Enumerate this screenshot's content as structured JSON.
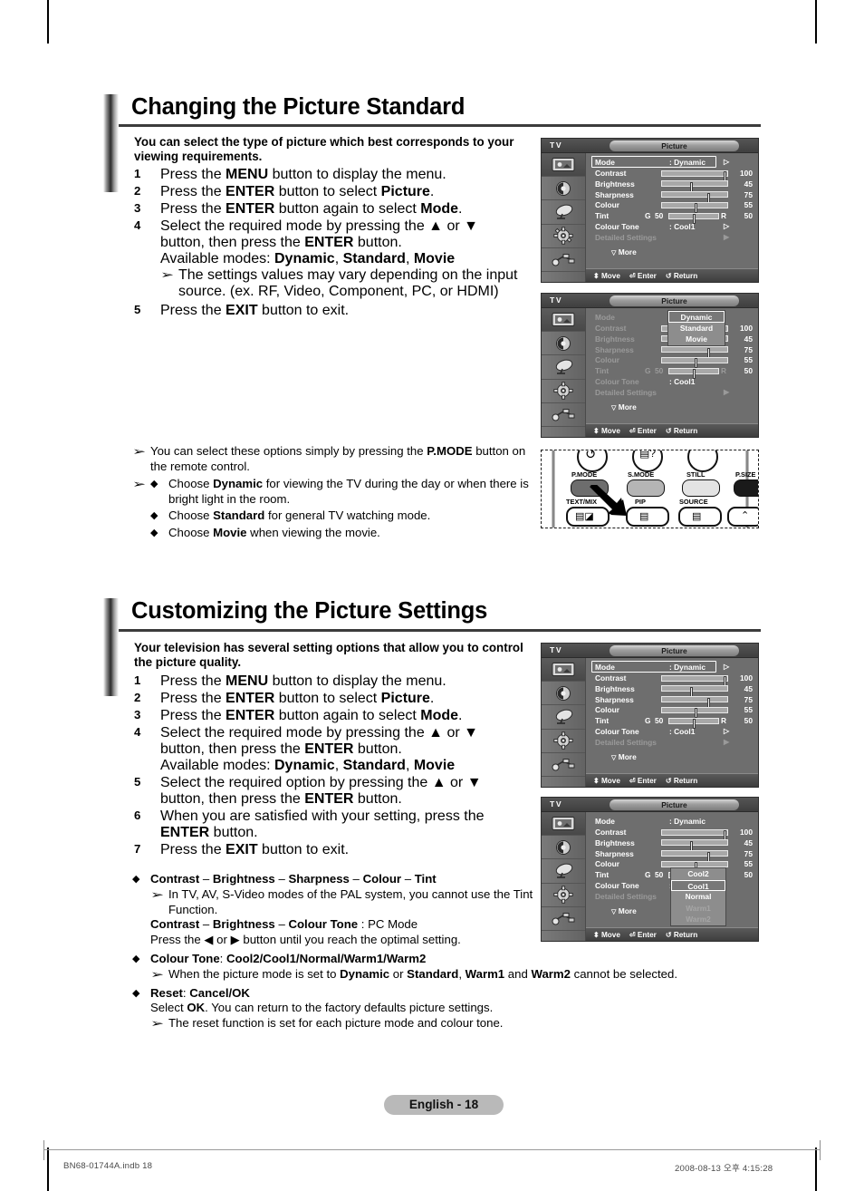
{
  "page": {
    "number_label": "English - 18",
    "footer_left": "BN68-01744A.indb   18",
    "footer_right": "2008-08-13   오후 4:15:28"
  },
  "sections": [
    {
      "heading": "Changing the Picture Standard",
      "intro": "You can select the type of picture which best corresponds to your viewing requirements.",
      "steps": [
        {
          "num": "1",
          "text_parts": "Press the MENU button to display the menu."
        },
        {
          "num": "2",
          "text_parts": "Press the ENTER button to select Picture."
        },
        {
          "num": "3",
          "text_parts": "Press the ENTER button again to select Mode."
        },
        {
          "num": "4",
          "text_parts": "Select the required mode by pressing the ▲ or ▼ button, then press the ENTER button."
        }
      ],
      "available_modes_label": "Available modes:",
      "available_modes": "Dynamic, Standard, Movie",
      "note_under_step4": "The settings values may vary depending on the input source. (ex. RF, Video, Component, PC, or HDMI)",
      "step5": {
        "num": "5",
        "text": "Press the EXIT button to exit."
      },
      "notes": [
        "You can select these options simply by pressing the P.MODE button on the remote control."
      ],
      "choose_bullets": [
        "Choose Dynamic for viewing the TV during the day or when there is bright light in the room.",
        "Choose Standard for general TV watching mode.",
        "Choose Movie when viewing the movie."
      ]
    },
    {
      "heading": "Customizing the Picture Settings",
      "intro": "Your television has several setting options that allow you to control the picture quality.",
      "steps": [
        {
          "num": "1",
          "text_parts": "Press the MENU button to display the menu."
        },
        {
          "num": "2",
          "text_parts": "Press the ENTER button to select Picture."
        },
        {
          "num": "3",
          "text_parts": "Press the ENTER button again to select Mode."
        },
        {
          "num": "4",
          "text_parts": "Select the required mode by pressing the ▲ or ▼ button, then press the ENTER button."
        }
      ],
      "available_modes_label": "Available modes:",
      "available_modes": "Dynamic, Standard, Movie",
      "steps2": [
        {
          "num": "5",
          "text_parts": "Select the required option by pressing the ▲ or ▼ button, then press the ENTER button."
        },
        {
          "num": "6",
          "text_parts": "When you are satisfied with your setting, press the ENTER button."
        },
        {
          "num": "7",
          "text_parts": "Press the EXIT button to exit."
        }
      ],
      "bullets": [
        {
          "title": "Contrast – Brightness – Sharpness – Colour – Tint",
          "note": "In TV, AV, S-Video modes of the PAL system, you cannot use the Tint Function.",
          "line2_bold": "Contrast – Brightness – Colour Tone",
          "line2_rest": ": PC Mode",
          "line3": "Press the ◀ or ▶ button until you reach the optimal setting."
        },
        {
          "title": "Colour Tone: Cool2/Cool1/Normal/Warm1/Warm2",
          "note": "When the picture mode is set to Dynamic or Standard, Warm1 and Warm2 cannot be selected."
        },
        {
          "title": "Reset: Cancel/OK",
          "line1": "Select OK. You can return to the factory defaults picture settings.",
          "note": "The reset function is set for each picture mode and colour tone."
        }
      ]
    }
  ],
  "osd": {
    "tv_label": "TV",
    "title": "Picture",
    "sidebar_icons": [
      "picture-icon",
      "sound-icon",
      "channel-icon",
      "setup-icon",
      "input-icon"
    ],
    "rows": {
      "mode_label": "Mode",
      "mode_value": ": Dynamic",
      "contrast_label": "Contrast",
      "contrast_value": "100",
      "brightness_label": "Brightness",
      "brightness_value": "45",
      "sharpness_label": "Sharpness",
      "sharpness_value": "75",
      "colour_label": "Colour",
      "colour_value": "55",
      "tint_label": "Tint",
      "tint_g": "G",
      "tint_g_value": "50",
      "tint_r": "R",
      "tint_r_value": "50",
      "colour_tone_label": "Colour Tone",
      "colour_tone_value": ": Cool1",
      "colour_tone_value_blank": ":",
      "detailed_label": "Detailed Settings",
      "more_label": "More"
    },
    "bottom": {
      "move": "Move",
      "enter": "Enter",
      "return": "Return"
    },
    "mode_options": [
      "Dynamic",
      "Standard",
      "Movie"
    ],
    "tone_options": [
      "Cool2",
      "Cool1",
      "Normal",
      "Warm1",
      "Warm2"
    ]
  },
  "remote": {
    "labels_top": [
      "P.MODE",
      "S.MODE",
      "STILL",
      "P.SIZE"
    ],
    "labels_bottom": [
      "TEXT/MIX",
      "PIP",
      "SOURCE"
    ]
  },
  "chart_data": null
}
